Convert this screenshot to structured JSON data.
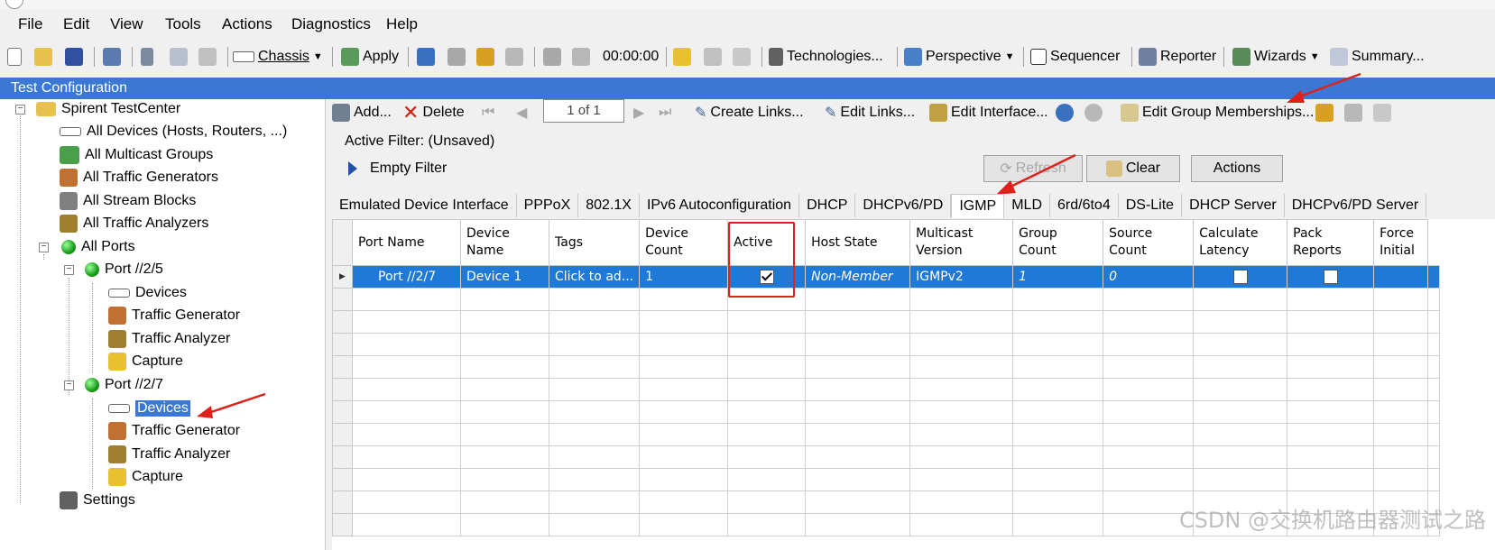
{
  "menu": [
    "File",
    "Edit",
    "View",
    "Tools",
    "Actions",
    "Diagnostics",
    "Help"
  ],
  "toolbar": {
    "chassis_label": "Chassis",
    "apply_label": "Apply",
    "timer": "00:00:00",
    "technologies_label": "Technologies...",
    "perspective_label": "Perspective",
    "sequencer_label": "Sequencer",
    "reporter_label": "Reporter",
    "wizards_label": "Wizards",
    "summary_label": "Summary..."
  },
  "panel_title": "Test Configuration",
  "tree": {
    "root": "Spirent TestCenter",
    "all_devices": "All Devices (Hosts, Routers, ...)",
    "all_multicast": "All Multicast Groups",
    "all_traffic_generators": "All Traffic Generators",
    "all_stream_blocks": "All Stream Blocks",
    "all_traffic_analyzers": "All Traffic Analyzers",
    "all_ports": "All Ports",
    "port1": "Port //2/5",
    "port2": "Port //2/7",
    "devices": "Devices",
    "traffic_generator": "Traffic Generator",
    "traffic_analyzer": "Traffic Analyzer",
    "capture": "Capture",
    "settings": "Settings"
  },
  "device_toolbar": {
    "add": "Add...",
    "delete": "Delete",
    "page": "1 of 1",
    "create_links": "Create Links...",
    "edit_links": "Edit Links...",
    "edit_interface": "Edit Interface...",
    "edit_group_memberships": "Edit Group Memberships..."
  },
  "filter": {
    "label": "Active Filter:  (Unsaved)",
    "empty": "Empty Filter",
    "refresh": "Refresh",
    "clear": "Clear",
    "actions": "Actions"
  },
  "tabs": [
    "Emulated Device Interface",
    "PPPoX",
    "802.1X",
    "IPv6 Autoconfiguration",
    "DHCP",
    "DHCPv6/PD",
    "IGMP",
    "MLD",
    "6rd/6to4",
    "DS-Lite",
    "DHCP Server",
    "DHCPv6/PD Server"
  ],
  "active_tab": "IGMP",
  "grid": {
    "columns": [
      {
        "l1": "Port Name",
        "l2": ""
      },
      {
        "l1": "Device",
        "l2": "Name"
      },
      {
        "l1": "Tags",
        "l2": ""
      },
      {
        "l1": "Device",
        "l2": "Count"
      },
      {
        "l1": "Active",
        "l2": ""
      },
      {
        "l1": "Host State",
        "l2": ""
      },
      {
        "l1": "Multicast",
        "l2": "Version"
      },
      {
        "l1": "Group",
        "l2": "Count"
      },
      {
        "l1": "Source",
        "l2": "Count"
      },
      {
        "l1": "Calculate",
        "l2": "Latency"
      },
      {
        "l1": "Pack",
        "l2": "Reports"
      },
      {
        "l1": "Force",
        "l2": "Initial"
      }
    ],
    "row": {
      "port_name": "Port //2/7",
      "device_name": "Device 1",
      "tags": "Click to ad...",
      "device_count": "1",
      "active": true,
      "host_state": "Non-Member",
      "multicast_version": "IGMPv2",
      "group_count": "1",
      "source_count": "0",
      "calculate_latency": false,
      "pack_reports": false
    }
  },
  "watermark": "CSDN @交换机路由器测试之路",
  "colors": {
    "title_bar": "#3a78d4",
    "selection": "#1e7ad6",
    "annotation": "#e0201a"
  }
}
